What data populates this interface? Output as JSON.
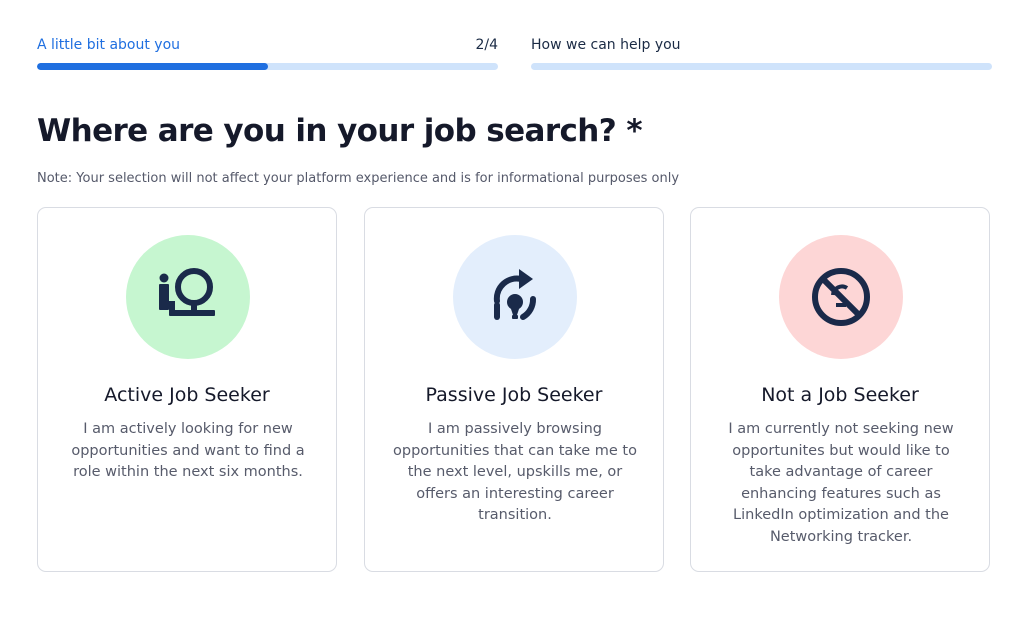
{
  "progress": {
    "step1_label": "A little bit about you",
    "step1_count": "2/4",
    "step1_fraction": 0.5,
    "step2_label": "How we can help you",
    "step2_fraction": 0
  },
  "heading": "Where are you in your job search? *",
  "note": "Note: Your selection will not affect your platform experience and is for informational purposes only",
  "cards": [
    {
      "title": "Active Job Seeker",
      "description": "I am actively looking for new opportunities and want to find a role within the next six months.",
      "icon": "person-with-sign-icon",
      "circle_color": "#c6f6d0"
    },
    {
      "title": "Passive Job Seeker",
      "description": "I am passively browsing opportunities that can take me to the next level, upskills me, or offers an interesting career transition.",
      "icon": "lightbulb-refresh-icon",
      "circle_color": "#e3eefc"
    },
    {
      "title": "Not a Job Seeker",
      "description": "I am currently not seeking new opportunites but would like to take advantage of career enhancing features such as LinkedIn optimization and the Networking tracker.",
      "icon": "no-lightbulb-icon",
      "circle_color": "#fdd6d6"
    }
  ],
  "colors": {
    "accent": "#1f6fe0",
    "bar_track": "#cfe3fb",
    "icon_dark": "#1a2a4a"
  }
}
